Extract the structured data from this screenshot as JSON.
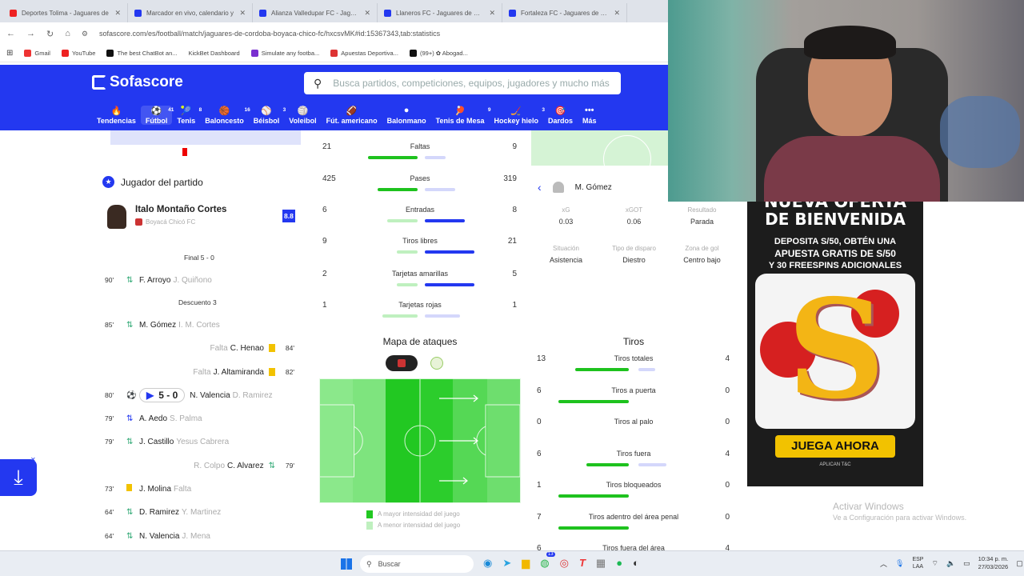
{
  "tabs": [
    {
      "title": "Deportes Tolima - Jaguares de",
      "color": "#e22"
    },
    {
      "title": "Marcador en vivo, calendario y",
      "color": "#2338f0"
    },
    {
      "title": "Alianza Valledupar FC - Jaguar",
      "color": "#2338f0"
    },
    {
      "title": "Llaneros FC - Jaguares de Cord",
      "color": "#2338f0"
    },
    {
      "title": "Fortaleza FC - Jaguares de Cor",
      "color": "#2338f0"
    }
  ],
  "url": "sofascore.com/es/football/match/jaguares-de-cordoba-boyaca-chico-fc/hxcsvMK#id:15367343,tab:statistics",
  "bookmarks": [
    {
      "label": "Gmail",
      "color": "#e33"
    },
    {
      "label": "YouTube",
      "color": "#e22"
    },
    {
      "label": "The best ChatBot an...",
      "color": "#111"
    },
    {
      "label": "KickBet Dashboard",
      "color": "#e6e6e6"
    },
    {
      "label": "Simulate any footba...",
      "color": "#7a2fd0"
    },
    {
      "label": "Apuestas Deportiva...",
      "color": "#d33"
    },
    {
      "label": "(99+) ✿ Abogad...",
      "color": "#111"
    }
  ],
  "brand": {
    "name": "Sofascore",
    "accent": "#2338f0"
  },
  "search": {
    "placeholder": "Busca partidos, competiciones, equipos, jugadores y mucho más"
  },
  "sports": [
    {
      "label": "Tendencias",
      "icon": "flame-icon",
      "count": ""
    },
    {
      "label": "Fútbol",
      "icon": "football-icon",
      "count": "41"
    },
    {
      "label": "Tenis",
      "icon": "tennis-icon",
      "count": "8"
    },
    {
      "label": "Baloncesto",
      "icon": "basketball-icon",
      "count": "16"
    },
    {
      "label": "Béisbol",
      "icon": "baseball-icon",
      "count": "3"
    },
    {
      "label": "Voleibol",
      "icon": "volleyball-icon",
      "count": ""
    },
    {
      "label": "Fút. americano",
      "icon": "american-football-icon",
      "count": ""
    },
    {
      "label": "Balonmano",
      "icon": "handball-icon",
      "count": ""
    },
    {
      "label": "Tenis de Mesa",
      "icon": "table-tennis-icon",
      "count": "9"
    },
    {
      "label": "Hockey hielo",
      "icon": "hockey-icon",
      "count": "3"
    },
    {
      "label": "Dardos",
      "icon": "darts-icon",
      "count": ""
    },
    {
      "label": "Más",
      "icon": "more-icon",
      "count": ""
    }
  ],
  "motm": {
    "heading": "Jugador del partido",
    "player": "Italo Montaño Cortes",
    "team": "Boyacá Chicó FC",
    "rating": "8.8"
  },
  "timeline": {
    "final": "Final 5 - 0",
    "added": "Descuento 3",
    "score_badge": "5 - 0",
    "events": [
      {
        "min": "90'",
        "type": "sub",
        "player": "F. Arroyo",
        "sub": "J. Quiñono",
        "side": "left"
      },
      {
        "min": "85'",
        "type": "sub",
        "player": "M. Gómez",
        "sub": "I. M. Cortes",
        "side": "left"
      },
      {
        "min": "84'",
        "type": "yellow",
        "player": "C. Henao",
        "sub": "Falta",
        "side": "right"
      },
      {
        "min": "82'",
        "type": "yellow",
        "player": "J. Altamiranda",
        "sub": "Falta",
        "side": "right"
      },
      {
        "min": "80'",
        "type": "goal",
        "player": "N. Valencia",
        "sub": "D. Ramirez",
        "side": "left"
      },
      {
        "min": "79'",
        "type": "sub",
        "player": "A. Aedo",
        "sub": "S. Palma",
        "side": "left"
      },
      {
        "min": "79'",
        "type": "sub",
        "player": "J. Castillo",
        "sub": "Yesus Cabrera",
        "side": "left"
      },
      {
        "min": "79'",
        "type": "sub",
        "player": "C. Alvarez",
        "sub": "R. Colpo",
        "side": "right"
      },
      {
        "min": "73'",
        "type": "yellow",
        "player": "J. Molina",
        "sub": "Falta",
        "side": "left"
      },
      {
        "min": "64'",
        "type": "sub",
        "player": "D. Ramirez",
        "sub": "Y. Martinez",
        "side": "left"
      },
      {
        "min": "64'",
        "type": "sub",
        "player": "N. Valencia",
        "sub": "J. Mena",
        "side": "left"
      }
    ]
  },
  "stats": [
    {
      "label": "Faltas",
      "home": "21",
      "away": "9",
      "home_frac": 0.7,
      "away_frac": 0.3
    },
    {
      "label": "Pases",
      "home": "425",
      "away": "319",
      "home_frac": 0.57,
      "away_frac": 0.43
    },
    {
      "label": "Entradas",
      "home": "6",
      "away": "8",
      "home_frac": 0.43,
      "away_frac": 0.57
    },
    {
      "label": "Tiros libres",
      "home": "9",
      "away": "21",
      "home_frac": 0.3,
      "away_frac": 0.7
    },
    {
      "label": "Tarjetas amarillas",
      "home": "2",
      "away": "5",
      "home_frac": 0.29,
      "away_frac": 0.71
    },
    {
      "label": "Tarjetas rojas",
      "home": "1",
      "away": "1",
      "home_frac": 0.5,
      "away_frac": 0.5
    }
  ],
  "shot_detail": {
    "player": "M. Gómez",
    "fields": [
      {
        "label": "xG",
        "value": "0.03"
      },
      {
        "label": "xGOT",
        "value": "0.06"
      },
      {
        "label": "Resultado",
        "value": "Parada"
      },
      {
        "label": "Situación",
        "value": "Asistencia"
      },
      {
        "label": "Tipo de disparo",
        "value": "Diestro"
      },
      {
        "label": "Zona de gol",
        "value": "Centro bajo"
      }
    ]
  },
  "attack_map": {
    "title": "Mapa de ataques",
    "legend_high": "A mayor intensidad del juego",
    "legend_low": "A menor intensidad del juego"
  },
  "shots": {
    "title": "Tiros",
    "rows": [
      {
        "label": "Tiros totales",
        "home": "13",
        "away": "4",
        "home_frac": 0.76,
        "away_frac": 0.24
      },
      {
        "label": "Tiros a puerta",
        "home": "6",
        "away": "0",
        "home_frac": 1.0,
        "away_frac": 0.0
      },
      {
        "label": "Tiros al palo",
        "home": "0",
        "away": "0",
        "home_frac": 0.0,
        "away_frac": 0.0
      },
      {
        "label": "Tiros fuera",
        "home": "6",
        "away": "4",
        "home_frac": 0.6,
        "away_frac": 0.4
      },
      {
        "label": "Tiros bloqueados",
        "home": "1",
        "away": "0",
        "home_frac": 1.0,
        "away_frac": 0.0
      },
      {
        "label": "Tiros adentro del área penal",
        "home": "7",
        "away": "0",
        "home_frac": 1.0,
        "away_frac": 0.0
      },
      {
        "label": "Tiros fuera del área",
        "home": "6",
        "away": "4",
        "home_frac": 0.6,
        "away_frac": 0.4
      }
    ]
  },
  "ad": {
    "line1": "NUEVA OFERTA",
    "line2": "DE BIENVENIDA",
    "line3": "DEPOSITA S/50, OBTÉN UNA",
    "line4": "APUESTA GRATIS DE S/50",
    "line5": "Y 30 FREESPINS ADICIONALES",
    "cta": "JUEGA AHORA",
    "fine": "APLICAN T&C"
  },
  "windows_watermark": {
    "title": "Activar Windows",
    "subtitle": "Ve a Configuración para activar Windows."
  },
  "taskbar": {
    "search": "Buscar",
    "lang": "ESP",
    "lang2": "LAA",
    "time": "10:34 p. m.",
    "date": "27/03/2026",
    "badge": "13"
  },
  "colors": {
    "home": "#1ec21e",
    "away": "#2338f0",
    "home_light": "#bff0bf",
    "away_light": "#d4d7fb"
  }
}
